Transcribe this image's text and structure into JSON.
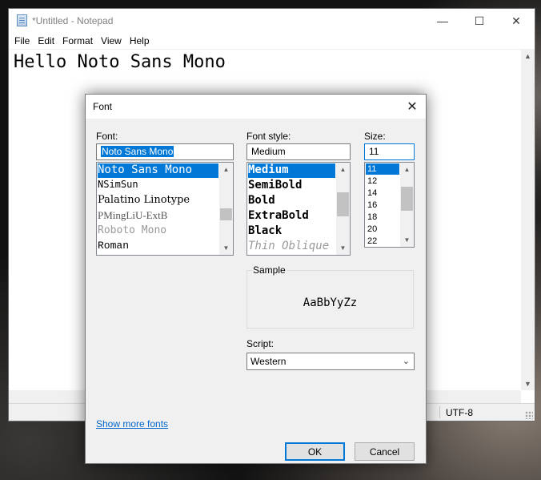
{
  "notepad": {
    "title": "*Untitled - Notepad",
    "menu": [
      "File",
      "Edit",
      "Format",
      "View",
      "Help"
    ],
    "content": "Hello Noto Sans Mono",
    "status": {
      "encoding": "UTF-8"
    }
  },
  "dialog": {
    "title": "Font",
    "font": {
      "label": "Font:",
      "value": "Noto Sans Mono",
      "items": [
        "Noto Sans Mono",
        "NSimSun",
        "Palatino Linotype",
        "PMingLiU-ExtB",
        "Roboto Mono",
        "Roman"
      ]
    },
    "style": {
      "label": "Font style:",
      "value": "Medium",
      "items": [
        "Medium",
        "SemiBold",
        "Bold",
        "ExtraBold",
        "Black",
        "Thin Oblique"
      ]
    },
    "size": {
      "label": "Size:",
      "value": "11",
      "items": [
        "11",
        "12",
        "14",
        "16",
        "18",
        "20",
        "22"
      ]
    },
    "sample": {
      "label": "Sample",
      "text": "AaBbYyZz"
    },
    "script": {
      "label": "Script:",
      "value": "Western"
    },
    "show_more_fonts": "Show more fonts",
    "ok_label": "OK",
    "cancel_label": "Cancel"
  }
}
